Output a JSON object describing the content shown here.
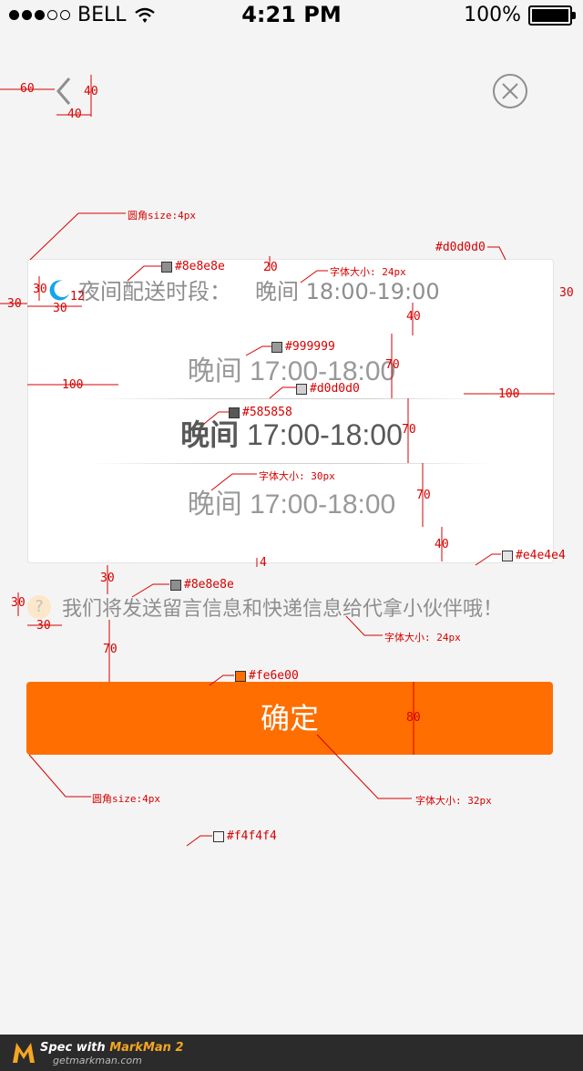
{
  "status_bar": {
    "carrier": "BELL",
    "time": "4:21 PM",
    "battery": "100%",
    "battery_level": 1.0
  },
  "night_delivery": {
    "label": "夜间配送时段：",
    "value": "晚间 18:00-19:00"
  },
  "time_options": [
    {
      "day": "晚间",
      "time": "17:00-18:00"
    },
    {
      "day": "晚间",
      "time": "17:00-18:00"
    },
    {
      "day": "晚间",
      "time": "17:00-18:00"
    }
  ],
  "hint": {
    "icon": "?",
    "text": "我们将发送留言信息和快递信息给代拿小伙伴哦！"
  },
  "confirm_button": {
    "label": "确定"
  },
  "colors": {
    "brand_orange": "#fe6e00",
    "background": "#f4f4f4",
    "gray_text": "#8e8e8e",
    "option_gray": "#999999",
    "option_selected": "#585858",
    "divider": "#d0d0d0",
    "card_border": "#e4e4e4"
  },
  "annotations": {
    "m60": "60",
    "m40a": "40",
    "m40b": "40",
    "radius_card": "圆角size:4px",
    "color_8e_a": "#8e8e8e",
    "m20": "20",
    "font24_a": "字体大小: 24px",
    "color_d0_a": "#d0d0d0",
    "m30a": "30",
    "m12": "12",
    "m30b": "30",
    "m30c": "30",
    "m30d": "30",
    "m40c": "40",
    "color_99": "#999999",
    "m70a": "70",
    "m100a": "100",
    "m100b": "100",
    "color_d0_b": "#d0d0d0",
    "color_58": "#585858",
    "m70b": "70",
    "font30": "字体大小: 30px",
    "m70c": "70",
    "m40d": "40",
    "m4": "4",
    "color_e4": "#e4e4e4",
    "m30e": "30",
    "color_8e_b": "#8e8e8e",
    "m30f": "30",
    "m30g": "30",
    "font24_b": "字体大小: 24px",
    "m70d": "70",
    "color_fe": "#fe6e00",
    "m80": "80",
    "radius_btn": "圆角size:4px",
    "font32": "字体大小: 32px",
    "color_f4": "#f4f4f4"
  },
  "footer": {
    "line1_prefix": "Spec with ",
    "line1_brand": "MarkMan 2",
    "line2": "getmarkman.com"
  }
}
